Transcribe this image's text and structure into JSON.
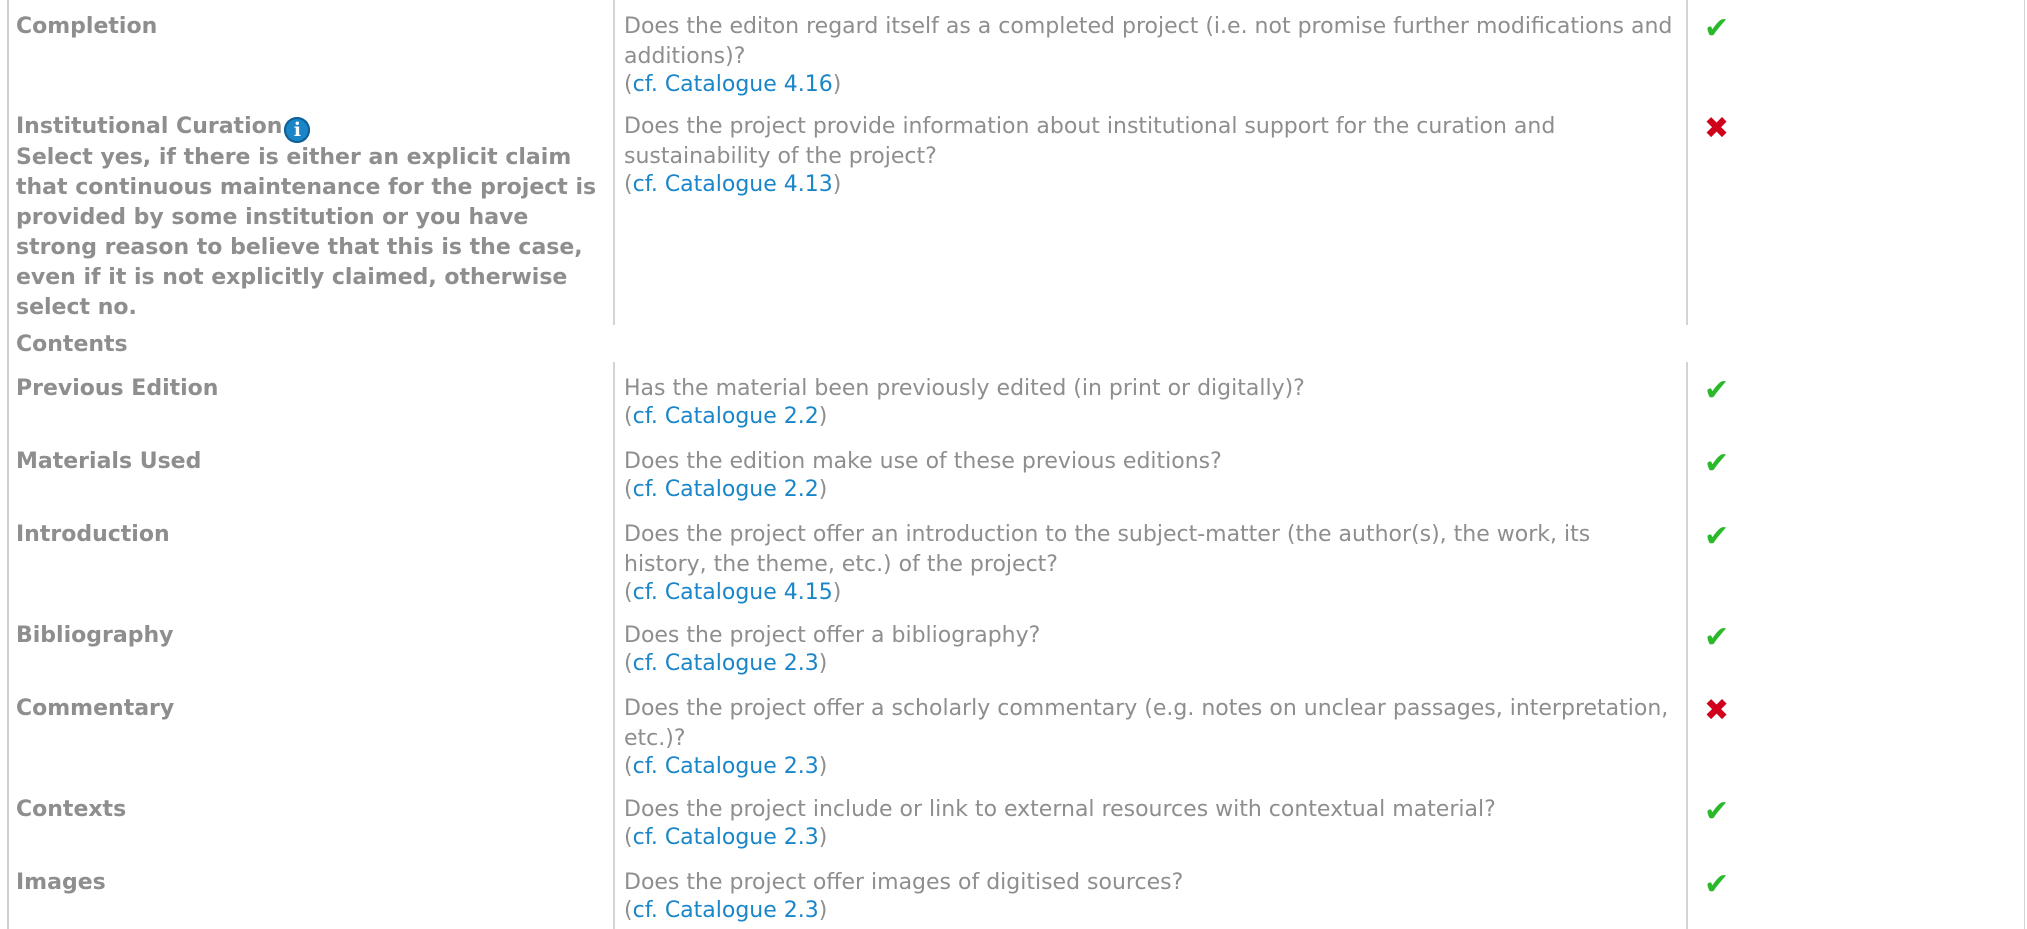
{
  "rows": [
    {
      "label": "Completion",
      "question": "Does the editon regard itself as a completed project (i.e. not promise further modifications and additions)?",
      "ref": "cf. Catalogue 4.16",
      "value": "yes"
    },
    {
      "label": "Institutional Curation",
      "note": "Select yes, if there is either an explicit claim that continuous maintenance for the project is provided by some institution or you have strong reason to believe that this is the case, even if it is not explicitly claimed, otherwise select no.",
      "question": "Does the project provide information about institutional support for the curation and sustainability of the project?",
      "ref": "cf. Catalogue 4.13",
      "value": "no"
    },
    {
      "section": "Contents"
    },
    {
      "label": "Previous Edition",
      "question": "Has the material been previously edited (in print or digitally)?",
      "ref": "cf. Catalogue 2.2",
      "value": "yes"
    },
    {
      "label": "Materials Used",
      "question": "Does the edition make use of these previous editions?",
      "ref": "cf. Catalogue 2.2",
      "value": "yes"
    },
    {
      "label": "Introduction",
      "question": "Does the project offer an introduction to the subject-matter (the author(s), the work, its history, the theme, etc.) of the project?",
      "ref": "cf. Catalogue 4.15",
      "value": "yes"
    },
    {
      "label": "Bibliography",
      "question": "Does the project offer a bibliography?",
      "ref": "cf. Catalogue 2.3",
      "value": "yes"
    },
    {
      "label": "Commentary",
      "question": "Does the project offer a scholarly commentary (e.g. notes on unclear passages, interpretation, etc.)?",
      "ref": "cf. Catalogue 2.3",
      "value": "no"
    },
    {
      "label": "Contexts",
      "question": "Does the project include or link to external resources with contextual material?",
      "ref": "cf. Catalogue 2.3",
      "value": "yes"
    },
    {
      "label": "Images",
      "question": "Does the project offer images of digitised sources?",
      "ref": "cf. Catalogue 2.3",
      "value": "yes"
    }
  ],
  "icons": {
    "yes": "✔",
    "no": "✖",
    "info": "i"
  },
  "colors": {
    "text": "#8e8e8e",
    "link": "#1a86c8",
    "check": "#2bb82b",
    "cross": "#d0021b"
  }
}
